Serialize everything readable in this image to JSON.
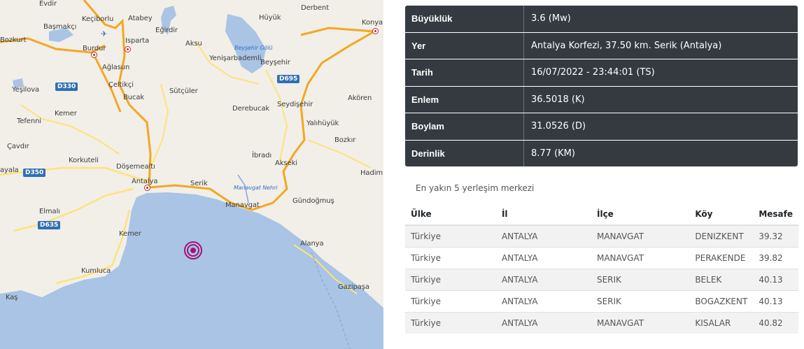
{
  "map": {
    "labels": {
      "evdir": "Evdir",
      "kecibor": "Keçiborlu",
      "atabey": "Atabey",
      "huyuk": "Hüyük",
      "derbent": "Derbent",
      "konya": "Konya",
      "basmakci": "Başmakçı",
      "egirdir": "Eğirdir",
      "bozkurt": "Bozkurt",
      "burdur": "Burdur",
      "isparta": "Isparta",
      "aksu": "Aksu",
      "beysehir_golu": "Beyşehir Gölü",
      "yenisar": "Yenişarbademli",
      "beysehir": "Beyşehir",
      "aglasun": "Ağlasun",
      "yesilova": "Yeşilova",
      "celtikci": "Çeltikçi",
      "sutculer": "Sütçüler",
      "bucak": "Bucak",
      "akoren": "Akören",
      "derebucak": "Derebucak",
      "seydisehir": "Seydişehir",
      "kemer_n": "Kemer",
      "tefenni": "Tefenni",
      "yalihuyuk": "Yalıhüyük",
      "cavdir": "Çavdır",
      "bozkir": "Bozkır",
      "korkuteli": "Korkuteli",
      "ibradi": "İbradı",
      "akseki": "Akseki",
      "dosemealti": "Döşemealtı",
      "hadim": "Hadim",
      "ayala": "ayala",
      "antalya": "Antalya",
      "serik": "Serik",
      "manavgat_nehri": "Manavgat Nehri",
      "gundogmus": "Gündoğmuş",
      "manavgat": "Manavgat",
      "elmali": "Elmalı",
      "kemer": "Kemer",
      "alanya": "Alanya",
      "kumluca": "Kumluca",
      "gazipasa": "Gazipaşa",
      "kas": "Kaş"
    },
    "shields": {
      "d330": "D330",
      "d695": "D695",
      "d350": "D350",
      "d635": "D635"
    },
    "colors": {
      "land": "#f1efe8",
      "sea": "#a9c4e4",
      "motorway": "#f5a623",
      "road": "#ffe27a",
      "marker": "#a5127a"
    }
  },
  "info": {
    "rows": [
      {
        "key": "Büyüklük",
        "value": "3.6 (Mw)"
      },
      {
        "key": "Yer",
        "value": "Antalya Korfezi, 37.50 km. Serik (Antalya)"
      },
      {
        "key": "Tarih",
        "value": "16/07/2022 - 23:44:01 (TS)"
      },
      {
        "key": "Enlem",
        "value": "36.5018 (K)"
      },
      {
        "key": "Boylam",
        "value": "31.0526 (D)"
      },
      {
        "key": "Derinlik",
        "value": "8.77 (KM)"
      }
    ]
  },
  "nearest": {
    "title": "En yakın 5 yerleşim merkezi",
    "headers": [
      "Ülke",
      "İl",
      "İlçe",
      "Köy",
      "Mesafe"
    ],
    "rows": [
      [
        "Türkiye",
        "ANTALYA",
        "MANAVGAT",
        "DENIZKENT",
        "39.32"
      ],
      [
        "Türkiye",
        "ANTALYA",
        "MANAVGAT",
        "PERAKENDE",
        "39.82"
      ],
      [
        "Türkiye",
        "ANTALYA",
        "SERIK",
        "BELEK",
        "40.13"
      ],
      [
        "Türkiye",
        "ANTALYA",
        "SERIK",
        "BOGAZKENT",
        "40.13"
      ],
      [
        "Türkiye",
        "ANTALYA",
        "MANAVGAT",
        "KISALAR",
        "40.82"
      ]
    ]
  }
}
